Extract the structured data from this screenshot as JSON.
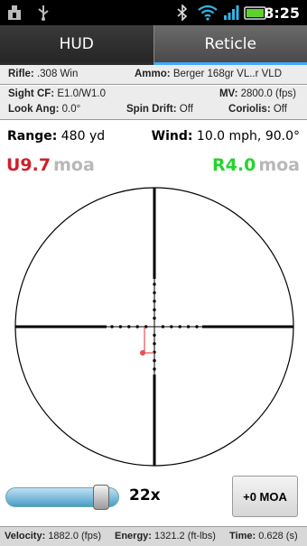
{
  "status_bar": {
    "time": "8:25",
    "icons": [
      "download-icon",
      "usb-icon",
      "bluetooth-icon",
      "wifi-icon",
      "signal-icon",
      "battery-icon"
    ]
  },
  "tabs": [
    {
      "label": "HUD",
      "selected": true
    },
    {
      "label": "Reticle",
      "selected": false
    }
  ],
  "info": {
    "rifle_label": "Rifle:",
    "rifle_value": ".308 Win",
    "ammo_label": "Ammo:",
    "ammo_value": "Berger 168gr VL..r VLD",
    "sight_label": "Sight CF:",
    "sight_value": "E1.0/W1.0",
    "mv_label": "MV:",
    "mv_value": "2800.0 (fps)",
    "look_label": "Look Ang:",
    "look_value": "0.0°",
    "spin_label": "Spin Drift:",
    "spin_value": "Off",
    "coriolis_label": "Coriolis:",
    "coriolis_value": "Off"
  },
  "solution": {
    "range_label": "Range:",
    "range_value": "480 yd",
    "wind_label": "Wind:",
    "wind_value": "10.0 mph, 90.0°",
    "elevation": "U9.7",
    "elevation_unit": "moa",
    "windage": "R4.0",
    "windage_unit": "moa"
  },
  "colors": {
    "elevation": "#d0202a",
    "windage": "#26d42c",
    "impact_marker": "#e85050"
  },
  "controls": {
    "zoom_label": "22x",
    "zoom_fraction": 0.9,
    "moa_button": "+0 MOA"
  },
  "footer": {
    "velocity_label": "Velocity:",
    "velocity_value": "1882.0 (fps)",
    "energy_label": "Energy:",
    "energy_value": "1321.2 (ft-lbs)",
    "time_label": "Time:",
    "time_value": "0.628 (s)"
  }
}
